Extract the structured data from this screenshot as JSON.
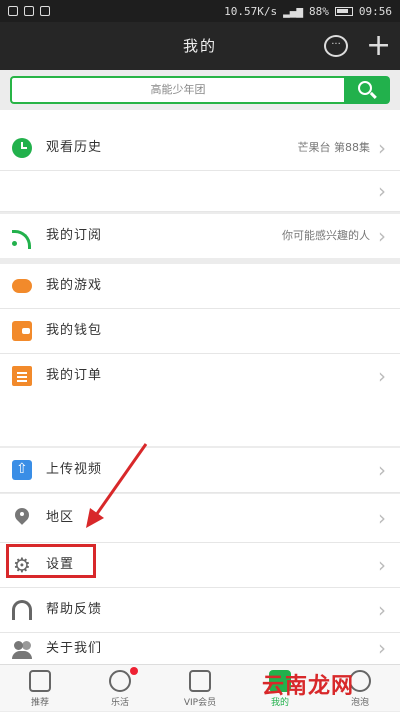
{
  "status_bar": {
    "speed": "10.57K/s",
    "battery": "88%",
    "time": "09:56"
  },
  "header": {
    "title": "我的",
    "message_icon": "chat-bubble-icon",
    "add_icon": "plus-icon"
  },
  "search": {
    "placeholder": "高能少年团"
  },
  "menu": {
    "history": {
      "label": "观看历史",
      "extra": "芒果台 第88集"
    },
    "subscribe": {
      "label": "我的订阅",
      "extra": "你可能感兴趣的人"
    },
    "games": {
      "label": "我的游戏"
    },
    "wallet": {
      "label": "我的钱包"
    },
    "orders": {
      "label": "我的订单"
    },
    "upload": {
      "label": "上传视频"
    },
    "location": {
      "label": "地区"
    },
    "settings": {
      "label": "设置"
    },
    "feedback": {
      "label": "帮助反馈"
    },
    "about": {
      "label": "关于我们"
    }
  },
  "tabs": [
    {
      "label": "推荐",
      "active": false
    },
    {
      "label": "乐活",
      "active": false,
      "badge": true
    },
    {
      "label": "VIP会员",
      "active": false
    },
    {
      "label": "我的",
      "active": true
    },
    {
      "label": "泡泡",
      "active": false
    }
  ],
  "watermark": "云南龙网",
  "colors": {
    "accent": "#22b14c",
    "highlight": "#d8282a"
  }
}
